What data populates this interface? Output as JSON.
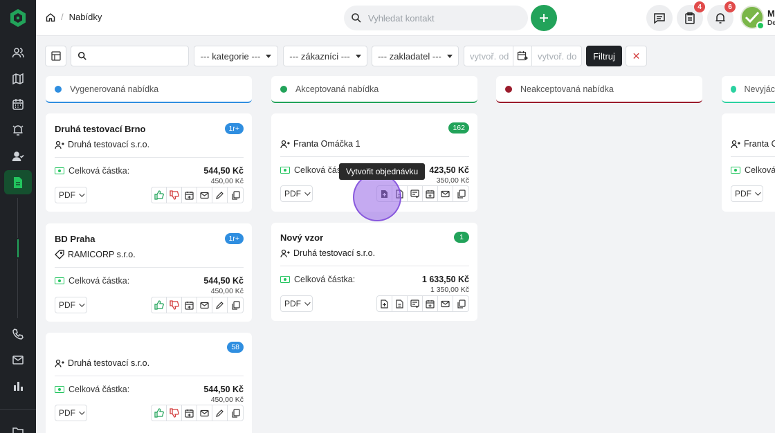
{
  "breadcrumb": {
    "current": "Nabídky"
  },
  "search": {
    "placeholder": "Vyhledat kontakt"
  },
  "badges": {
    "tasks": "4",
    "notifications": "6"
  },
  "user": {
    "name": "M",
    "sub": "De"
  },
  "filters": {
    "kategorie": "--- kategorie ---",
    "zakaznici": "--- zákazníci ---",
    "zakladatel": "--- zakladatel ---",
    "date_from_placeholder": "vytvoř. od",
    "date_to_placeholder": "vytvoř. do",
    "filter_button": "Filtruj",
    "clear": "✕"
  },
  "columns": [
    {
      "label": "Vygenerovaná nabídka",
      "color": "#2f8ee0"
    },
    {
      "label": "Akceptovaná nabídka",
      "color": "#22a35a"
    },
    {
      "label": "Neakceptovaná nabídka",
      "color": "#9b1c2c"
    },
    {
      "label": "Nevyjác",
      "color": "#2bd1a0"
    }
  ],
  "cards": {
    "c1": {
      "title": "Druhá testovací Brno",
      "badge": "1r+",
      "company": "Druhá testovací s.r.o.",
      "amount_label": "Celková částka:",
      "amount": "544,50 Kč",
      "amount_sub": "450,00 Kč",
      "pdf": "PDF"
    },
    "c2": {
      "title": "BD Praha",
      "badge": "1r+",
      "company": "RAMICORP s.r.o.",
      "amount_label": "Celková částka:",
      "amount": "544,50 Kč",
      "amount_sub": "450,00 Kč",
      "pdf": "PDF"
    },
    "c3": {
      "badge": "58",
      "company": "Druhá testovací s.r.o.",
      "amount_label": "Celková částka:",
      "amount": "544,50 Kč",
      "amount_sub": "450,00 Kč",
      "pdf": "PDF"
    },
    "c4": {
      "badge": "162",
      "company": "Franta Omáčka 1",
      "amount_label": "Celková částka:",
      "amount": "423,50 Kč",
      "amount_sub": "350,00 Kč",
      "pdf": "PDF"
    },
    "c5": {
      "title": "Nový vzor",
      "badge": "1",
      "company": "Druhá testovací s.r.o.",
      "amount_label": "Celková částka:",
      "amount": "1 633,50 Kč",
      "amount_sub": "1 350,00 Kč",
      "pdf": "PDF"
    },
    "c6": {
      "company": "Franta O",
      "amount_label": "Celková",
      "pdf": "PDF"
    }
  },
  "tooltip": "Vytvořit objednávku",
  "colors": {
    "accent": "#22a35a",
    "sidebar": "#1f2226",
    "badge_blue": "#2f8ee0",
    "badge_green": "#22a35a"
  }
}
